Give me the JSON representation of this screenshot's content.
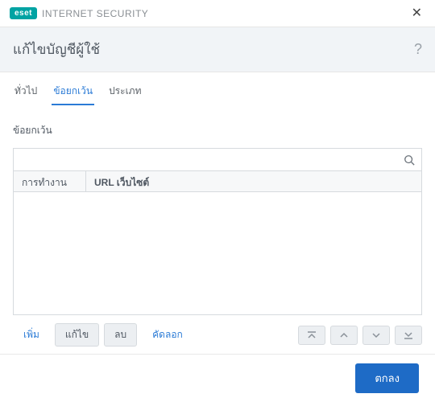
{
  "brand": {
    "badge": "eset",
    "product": "INTERNET SECURITY"
  },
  "header": {
    "title": "แก้ไขบัญชีผู้ใช้",
    "help": "?"
  },
  "tabs": [
    {
      "label": "ทั่วไป",
      "active": false
    },
    {
      "label": "ข้อยกเว้น",
      "active": true
    },
    {
      "label": "ประเภท",
      "active": false
    }
  ],
  "section": {
    "label": "ข้อยกเว้น"
  },
  "search": {
    "placeholder": ""
  },
  "table": {
    "columns": [
      "การทำงาน",
      "URL เว็บไซต์"
    ],
    "rows": []
  },
  "actions": {
    "add": "เพิ่ม",
    "edit": "แก้ไข",
    "delete": "ลบ",
    "copy": "คัดลอก"
  },
  "footer": {
    "ok": "ตกลง"
  }
}
